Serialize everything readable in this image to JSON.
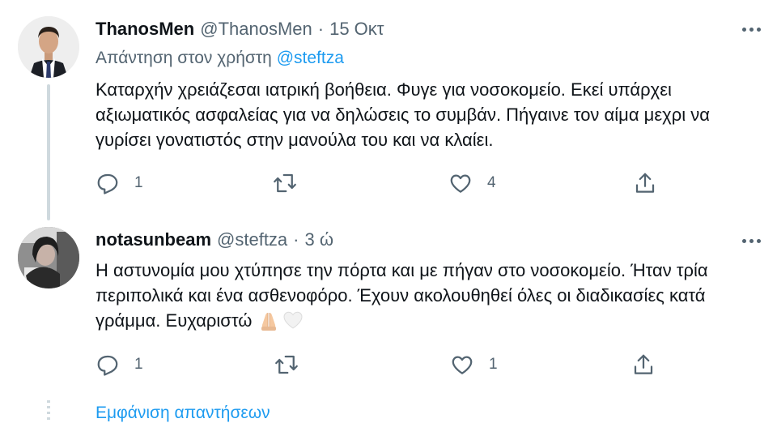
{
  "tweets": [
    {
      "name": "ThanosMen",
      "handle": "@ThanosMen",
      "separator": "·",
      "time": "15 Οκτ",
      "reply_prefix": "Απάντηση στον χρήστη",
      "reply_mention": "@steftza",
      "text": "Καταρχήν χρειάζεσαι ιατρική βοήθεια. Φυγε για νοσοκομείο. Εκεί υπάρχει αξιωματικός ασφαλείας για να δηλώσεις το συμβάν. Πήγαινε τον αίμα μεχρι να γυρίσει γονατιστός στην μανούλα του και να κλαίει.",
      "reply_count": "1",
      "like_count": "4",
      "icons": [
        "reply-icon",
        "retweet-icon",
        "like-icon",
        "share-icon",
        "more-icon"
      ]
    },
    {
      "name": "notasunbeam",
      "handle": "@steftza",
      "separator": "·",
      "time": "3 ώ",
      "text": "Η αστυνομία μου χτύπησε την πόρτα και με πήγαν στο νοσοκομείο. Ήταν τρία περιπολικά και ένα ασθενοφόρο. Έχουν ακολουθηθεί όλες οι διαδικασίες κατά γράμμα. Ευχαριστώ",
      "emojis": [
        "folded-hands-emoji",
        "white-heart-emoji"
      ],
      "reply_count": "1",
      "like_count": "1",
      "icons": [
        "reply-icon",
        "retweet-icon",
        "like-icon",
        "share-icon",
        "more-icon"
      ]
    }
  ],
  "show_replies_label": "Εμφάνιση απαντήσεων",
  "colors": {
    "text": "#0f1419",
    "secondary": "#536471",
    "link": "#1d9bf0",
    "thread_line": "#cfd9de"
  }
}
